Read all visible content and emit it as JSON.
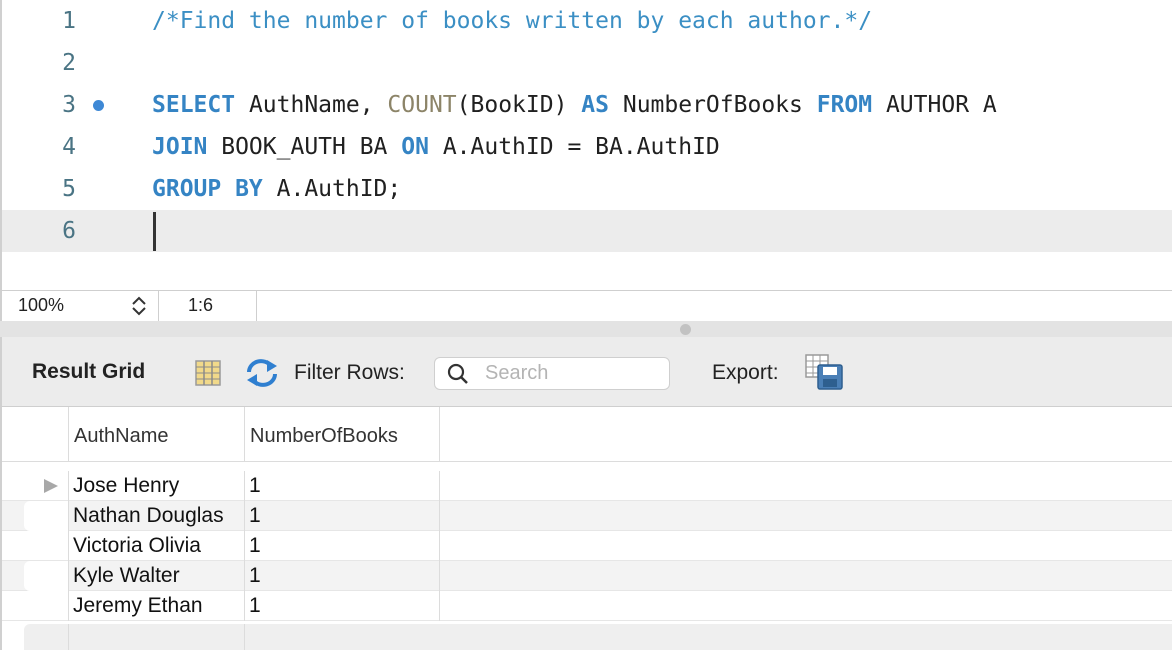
{
  "editor": {
    "lines": [
      {
        "num": "1",
        "tokens": [
          {
            "t": "/*Find the number of books written by each author.*/",
            "c": "cm"
          }
        ]
      },
      {
        "num": "2",
        "tokens": []
      },
      {
        "num": "3",
        "tokens": [
          {
            "t": "SELECT",
            "c": "kw"
          },
          {
            "t": " AuthName, ",
            "c": ""
          },
          {
            "t": "COUNT",
            "c": "fn"
          },
          {
            "t": "(BookID) ",
            "c": ""
          },
          {
            "t": "AS",
            "c": "kw"
          },
          {
            "t": " NumberOfBooks ",
            "c": ""
          },
          {
            "t": "FROM",
            "c": "kw"
          },
          {
            "t": " AUTHOR A",
            "c": ""
          }
        ]
      },
      {
        "num": "4",
        "tokens": [
          {
            "t": "JOIN",
            "c": "kw"
          },
          {
            "t": " BOOK_AUTH BA ",
            "c": ""
          },
          {
            "t": "ON",
            "c": "kw"
          },
          {
            "t": " A.AuthID = BA.AuthID",
            "c": ""
          }
        ]
      },
      {
        "num": "5",
        "tokens": [
          {
            "t": "GROUP BY",
            "c": "kw"
          },
          {
            "t": " A.AuthID;",
            "c": ""
          }
        ]
      },
      {
        "num": "6",
        "tokens": []
      }
    ],
    "colors": {
      "keyword": "#3584c4",
      "function": "#8c8468",
      "comment": "#3b8fc4",
      "line_number": "#4a7484",
      "breakpoint": "#3e88d5"
    }
  },
  "status": {
    "zoom": "100%",
    "position": "1:6"
  },
  "toolbar": {
    "title": "Result Grid",
    "filter_label": "Filter Rows:",
    "search_placeholder": "Search",
    "export_label": "Export:"
  },
  "grid": {
    "columns": [
      "AuthName",
      "NumberOfBooks"
    ],
    "rows": [
      [
        "Jose Henry",
        "1"
      ],
      [
        "Nathan Douglas",
        "1"
      ],
      [
        "Victoria Olivia",
        "1"
      ],
      [
        "Kyle Walter",
        "1"
      ],
      [
        "Jeremy Ethan",
        "1"
      ]
    ]
  }
}
